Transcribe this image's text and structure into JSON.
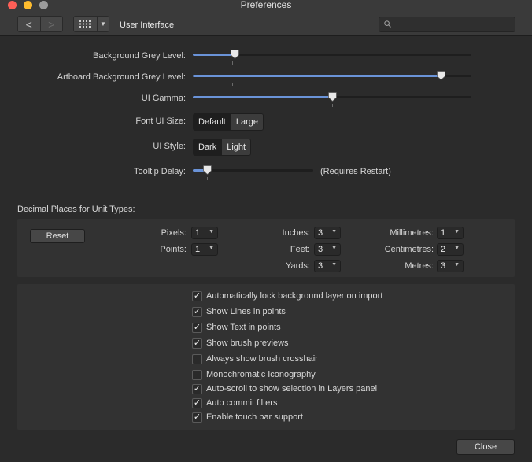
{
  "window": {
    "title": "Preferences"
  },
  "toolbar": {
    "section": "User Interface",
    "back_glyph": "<",
    "forward_glyph": ">",
    "dropdown_glyph": "▼"
  },
  "sliders": [
    {
      "label": "Background Grey Level:",
      "value": 0.15
    },
    {
      "label": "Artboard Background Grey Level:",
      "value": 0.89
    },
    {
      "label": "UI Gamma:",
      "value": 0.5
    }
  ],
  "font_ui_size": {
    "label": "Font UI Size:",
    "options": [
      "Default",
      "Large"
    ],
    "selected": "Default"
  },
  "ui_style": {
    "label": "UI Style:",
    "options": [
      "Dark",
      "Light"
    ],
    "selected": "Dark"
  },
  "tooltip_delay": {
    "label": "Tooltip Delay:",
    "value": 0.12,
    "note": "(Requires Restart)"
  },
  "decimal": {
    "heading": "Decimal Places for Unit Types:",
    "reset_label": "Reset",
    "units": [
      {
        "label": "Pixels:",
        "value": "1"
      },
      {
        "label": "Points:",
        "value": "1"
      },
      {
        "label": "Inches:",
        "value": "3"
      },
      {
        "label": "Feet:",
        "value": "3"
      },
      {
        "label": "Yards:",
        "value": "3"
      },
      {
        "label": "Millimetres:",
        "value": "1"
      },
      {
        "label": "Centimetres:",
        "value": "2"
      },
      {
        "label": "Metres:",
        "value": "3"
      }
    ]
  },
  "options": [
    {
      "label": "Automatically lock background layer on import",
      "checked": true
    },
    {
      "label": "Show Lines in points",
      "checked": true
    },
    {
      "label": "Show Text in points",
      "checked": true
    },
    {
      "label": "Show brush previews",
      "checked": true
    },
    {
      "label": "Always show brush crosshair",
      "checked": false
    },
    {
      "label": "Monochromatic Iconography",
      "checked": false
    },
    {
      "label": "Auto-scroll to show selection in Layers panel",
      "checked": true
    },
    {
      "label": "Auto commit filters",
      "checked": true
    },
    {
      "label": "Enable touch bar support",
      "checked": true
    }
  ],
  "footer": {
    "close_label": "Close"
  },
  "colors": {
    "accent": "#6a93d8",
    "background": "#2b2b2b",
    "panel": "#323232"
  }
}
